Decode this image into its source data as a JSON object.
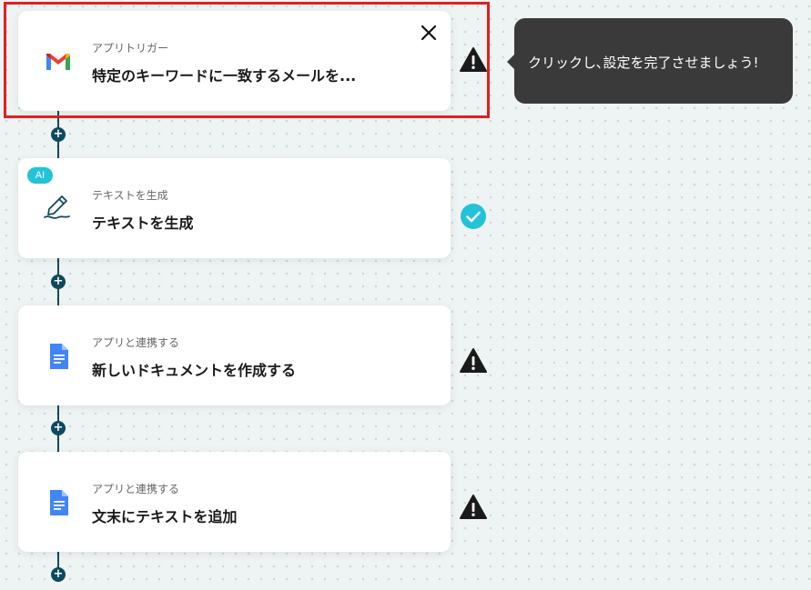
{
  "tooltip": {
    "text": "クリックし､設定を完了させましょう!"
  },
  "steps": [
    {
      "sub": "アプリトリガー",
      "title": "特定のキーワードに一致するメールを...",
      "icon": "gmail-icon",
      "status": "warning-icon"
    },
    {
      "sub": "テキストを生成",
      "title": "テキストを生成",
      "icon": "pen-icon",
      "status": "check-icon",
      "badge": "AI"
    },
    {
      "sub": "アプリと連携する",
      "title": "新しいドキュメントを作成する",
      "icon": "google-docs-icon",
      "status": "warning-icon"
    },
    {
      "sub": "アプリと連携する",
      "title": "文末にテキストを追加",
      "icon": "google-docs-icon",
      "status": "warning-icon"
    }
  ],
  "add_step_label": "+",
  "colors": {
    "connector": "#0d4a5e",
    "highlight": "#e02020",
    "check": "#22c3d8",
    "tooltip_bg": "#3a3a3a"
  }
}
